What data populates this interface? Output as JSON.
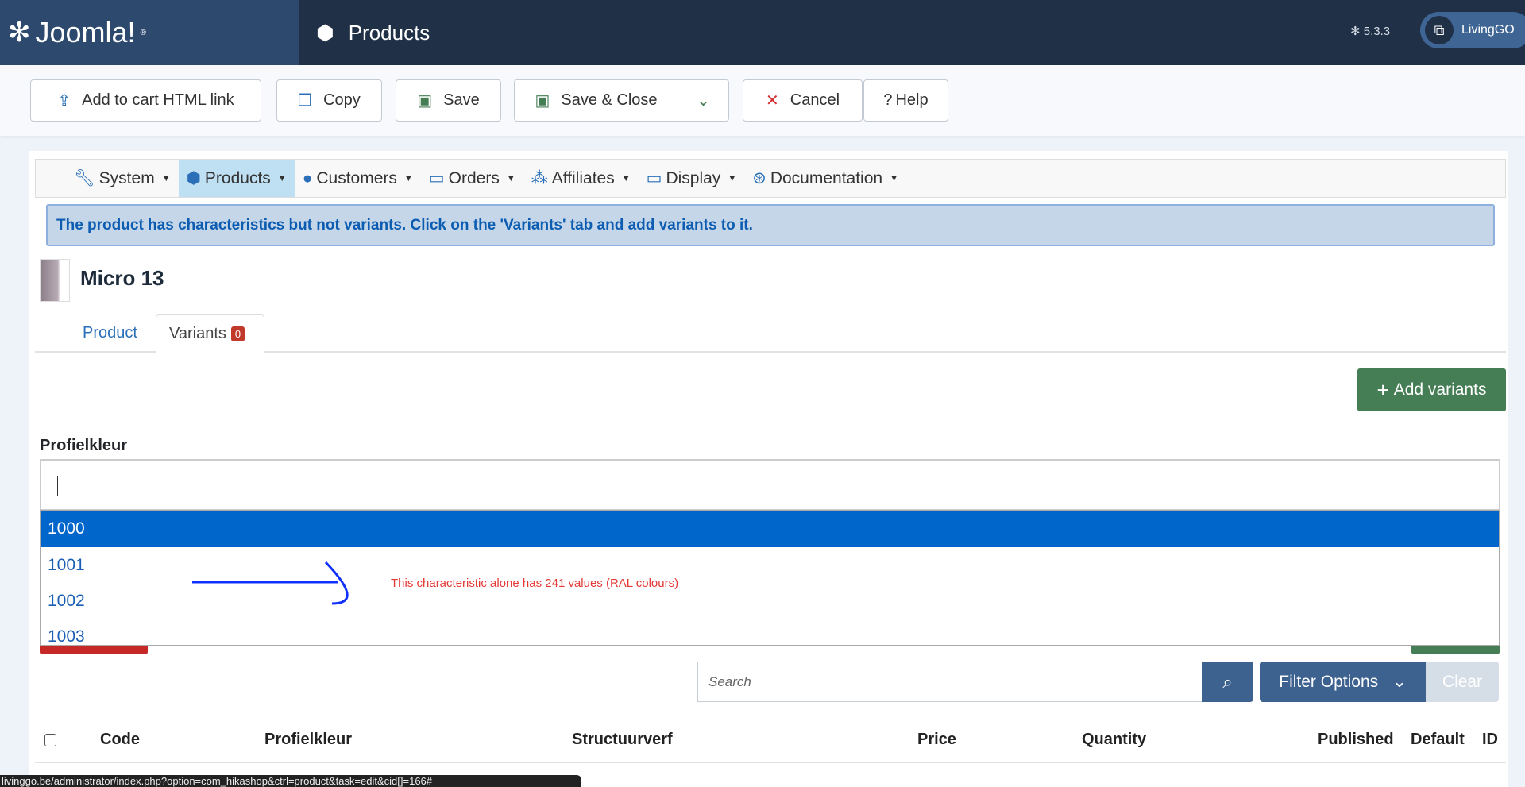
{
  "header": {
    "brand": "Joomla!",
    "title": "Products",
    "version": "5.3.3",
    "user": "LivingGO"
  },
  "toolbar": {
    "add_to_cart": "Add to cart HTML link",
    "copy": "Copy",
    "save": "Save",
    "save_close": "Save & Close",
    "cancel": "Cancel",
    "help": "Help"
  },
  "menu": [
    {
      "label": "System"
    },
    {
      "label": "Products"
    },
    {
      "label": "Customers"
    },
    {
      "label": "Orders"
    },
    {
      "label": "Affiliates"
    },
    {
      "label": "Display"
    },
    {
      "label": "Documentation"
    }
  ],
  "alert": "The product has characteristics but not variants. Click on the 'Variants' tab and add variants to it.",
  "product": {
    "name": "Micro 13"
  },
  "tabs": {
    "product": "Product",
    "variants": "Variants",
    "variants_count": "0"
  },
  "add_variants": "Add variants",
  "characteristic": {
    "label": "Profielkleur",
    "options": [
      "1000",
      "1001",
      "1002",
      "1003"
    ]
  },
  "annotation": "This characteristic alone has 241 values (RAL colours)",
  "filter": {
    "search_placeholder": "Search",
    "filter_options": "Filter Options",
    "clear": "Clear"
  },
  "table": {
    "columns": [
      "Code",
      "Profielkleur",
      "Structuurverf",
      "Price",
      "Quantity",
      "Published",
      "Default",
      "ID"
    ]
  },
  "status_url": "livinggo.be/administrator/index.php?option=com_hikashop&ctrl=product&task=edit&cid[]=166#"
}
